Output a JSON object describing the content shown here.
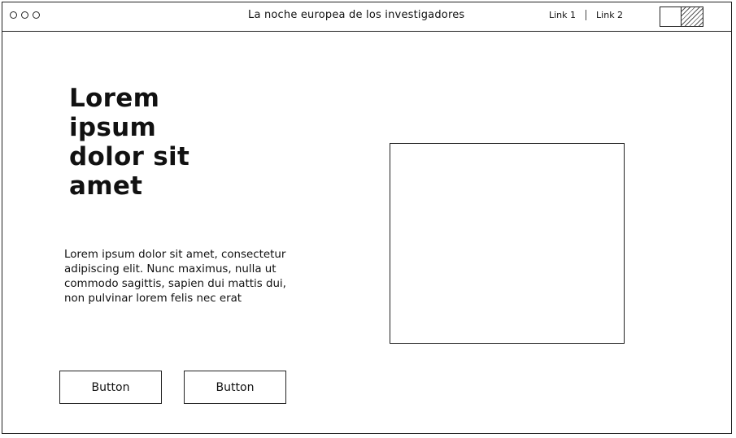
{
  "window": {
    "title": "La noche europea de los investigadores"
  },
  "nav": {
    "link1": "Link 1",
    "link2": "Link 2"
  },
  "hero": {
    "heading": "Lorem ipsum dolor sit amet",
    "paragraph": "Lorem ipsum dolor sit amet, consectetur adipiscing elit. Nunc maximus, nulla ut commodo sagittis, sapien dui mattis dui, non pulvinar lorem felis nec erat"
  },
  "buttons": {
    "primary_label": "Button",
    "secondary_label": "Button"
  }
}
